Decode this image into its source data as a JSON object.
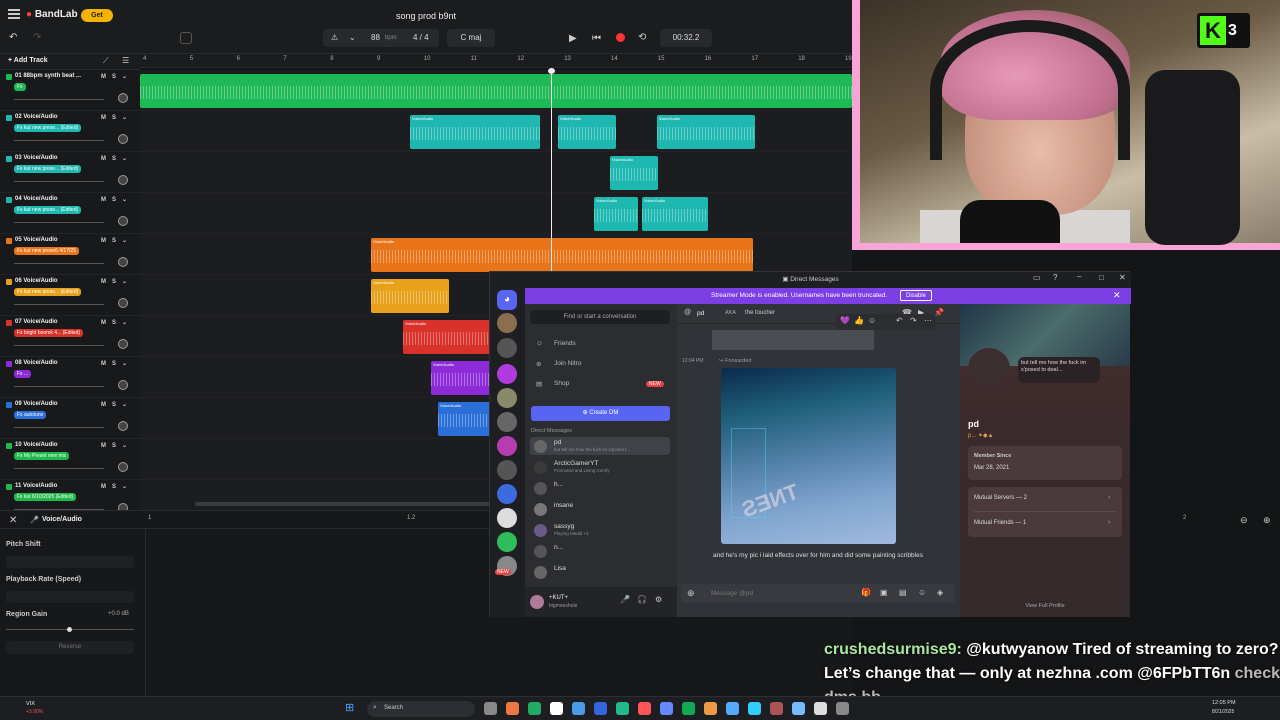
{
  "bandlab": {
    "logo": "BandLab",
    "get_button": "Get",
    "project_title": "song prod b9nt",
    "bpm_value": "88",
    "bpm_unit": "bpm",
    "time_signature": "4 / 4",
    "key": "C maj",
    "time_display": "00:32.2",
    "add_track": "Add Track",
    "ruler_ticks": [
      "4",
      "5",
      "6",
      "7",
      "8",
      "9",
      "10",
      "11",
      "12",
      "13",
      "14",
      "15",
      "16",
      "17",
      "18",
      "19"
    ],
    "tracks": [
      {
        "name": "01 88bpm synth beat ...",
        "preset": "Fx",
        "color": "#1db954"
      },
      {
        "name": "02 Voice/Audio",
        "preset": "Fx kut new prese... (Edited)",
        "color": "#1fb8b0"
      },
      {
        "name": "03 Voice/Audio",
        "preset": "Fx kut new prese... (Edited)",
        "color": "#1fb8b0"
      },
      {
        "name": "04 Voice/Audio",
        "preset": "Fx kut new prese... (Edited)",
        "color": "#1fb8b0"
      },
      {
        "name": "05 Voice/Audio",
        "preset": "Fx kut new prese6 4/17/25",
        "color": "#e8751a"
      },
      {
        "name": "06 Voice/Audio",
        "preset": "Fx kut new prese... (Edited)",
        "color": "#e8a11a"
      },
      {
        "name": "07 Voice/Audio",
        "preset": "Fx bright boomk 4... (Edited)",
        "color": "#d8322b"
      },
      {
        "name": "08 Voice/Audio",
        "preset": "Fx ...",
        "color": "#8e2bd8"
      },
      {
        "name": "09 Voice/Audio",
        "preset": "Fx autotune",
        "color": "#2b6fd8"
      },
      {
        "name": "10 Voice/Audio",
        "preset": "Fx My Preset new mix",
        "color": "#1fb84d"
      },
      {
        "name": "11 Voice/Audio",
        "preset": "Fx kut 6/10/2025 (Edited)",
        "color": "#1fb84d"
      }
    ],
    "clip_label": "Voice/Audio",
    "bottom_panel": {
      "title": "Voice/Audio",
      "pitch_shift": "Pitch Shift",
      "playback_rate": "Playback Rate (Speed)",
      "region_gain": "Region Gain",
      "region_gain_value": "+0.0 dB",
      "reverse": "Reverse",
      "ruler": [
        "1",
        "1.2",
        "2"
      ]
    }
  },
  "stream": {
    "kick_count": "3",
    "chat_user": "crushedsurmise9:",
    "chat_text": "@kutwyanow Tired of streaming to zero? Let’s change that — only at nezhna .com @6FPbTT6n",
    "overlay_text": "check dms bb"
  },
  "discord": {
    "title": "Direct Messages",
    "banner": "Streamer Mode is enabled. Usernames have been truncated.",
    "banner_button": "Disable",
    "search_placeholder": "Find or start a conversation",
    "nav": [
      "Friends",
      "Join Nitro",
      "Shop"
    ],
    "shop_badge": "NEW",
    "create_dm": "Create DM",
    "dm_header": "Direct Messages",
    "dms": [
      {
        "name": "pd",
        "sub": "but tell me how the fuck im s'posed t..."
      },
      {
        "name": "ArcticGamerYT",
        "sub": "Promoted and Living Comfy"
      },
      {
        "name": "h...",
        "sub": ""
      },
      {
        "name": "insane",
        "sub": ""
      },
      {
        "name": "sassyg",
        "sub": "Playing Medal +2"
      },
      {
        "name": "n...",
        "sub": ""
      },
      {
        "name": "Lisa",
        "sub": ""
      }
    ],
    "user_name": "+KUT+",
    "user_status": "bigmeeshole",
    "chat_header_name": "pd",
    "chat_header_aka": "AKA",
    "chat_header_nick": "the toucher",
    "time": "12:04 PM",
    "forwarded": "Forwarded",
    "message": "and he's my pic i laid effects over for him and did some painting scribbles",
    "message_placeholder": "Message @pd",
    "profile_name": "pd",
    "profile_status": "but tell me how the fuck im s'posed to deal...",
    "member_since_label": "Member Since",
    "member_since": "Mar 28, 2021",
    "mutual_servers": "Mutual Servers — 2",
    "mutual_friends": "Mutual Friends — 1",
    "view_profile": "View Full Profile",
    "new_badge": "NEW"
  },
  "taskbar": {
    "ticker": "VIX",
    "ticker_change": "+3.90%",
    "search": "Search",
    "time": "12:05 PM",
    "date": "8/21/2025"
  }
}
